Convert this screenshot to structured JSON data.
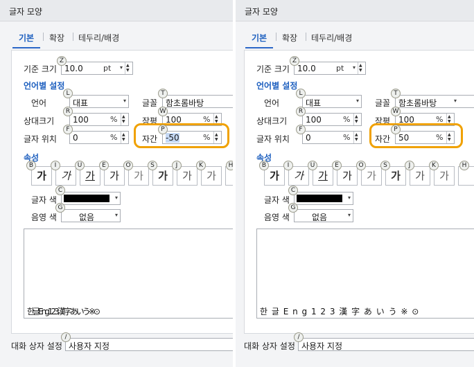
{
  "dialog_title": "글자 모양",
  "tabs": [
    "기본",
    "확장",
    "테두리/배경"
  ],
  "base_size": {
    "label": "기준 크기",
    "value": "10.0",
    "unit": "pt",
    "key": "Z"
  },
  "lang_group": "언어별 설정",
  "language": {
    "label": "언어",
    "value": "대표",
    "key": "L"
  },
  "font": {
    "label": "글꼴",
    "value": "함초롬바탕",
    "key": "T"
  },
  "relative_size": {
    "label": "상대크기",
    "value": "100",
    "unit": "%",
    "key": "R"
  },
  "width_ratio": {
    "label": "장평",
    "value": "100",
    "unit": "%",
    "key": "W"
  },
  "position": {
    "label": "글자 위치",
    "value": "0",
    "unit": "%",
    "key": "F"
  },
  "spacing": {
    "label": "자간",
    "unit": "%",
    "key": "P"
  },
  "attr_group": "속성",
  "attr_buttons": [
    {
      "glyph": "가",
      "key": "B"
    },
    {
      "glyph": "가",
      "key": "I"
    },
    {
      "glyph": "가",
      "key": "U"
    },
    {
      "glyph": "가",
      "key": "E"
    },
    {
      "glyph": "가",
      "key": "O"
    },
    {
      "glyph": "가",
      "key": "S"
    },
    {
      "glyph": "가",
      "key": "J"
    },
    {
      "glyph": "가",
      "key": "K"
    },
    {
      "glyph": "",
      "key": "H"
    }
  ],
  "text_color": {
    "label": "글자 색",
    "key": "C",
    "color": "#000000"
  },
  "shade_color": {
    "label": "음영 색",
    "value": "없음",
    "key": "G"
  },
  "footer": {
    "label": "대화 상자 설정",
    "value": "사용자 지정",
    "key": "/"
  },
  "left": {
    "spacing_value": "-50",
    "preview_text": "한글Eng123漢字あいう※⊙"
  },
  "right": {
    "spacing_value": "50",
    "preview_text": "한 글 E n g 1 2 3 漢 字 あ い う ※ ⊙"
  },
  "colors": {
    "accent": "#2a66c7",
    "highlight": "#f0a100"
  }
}
